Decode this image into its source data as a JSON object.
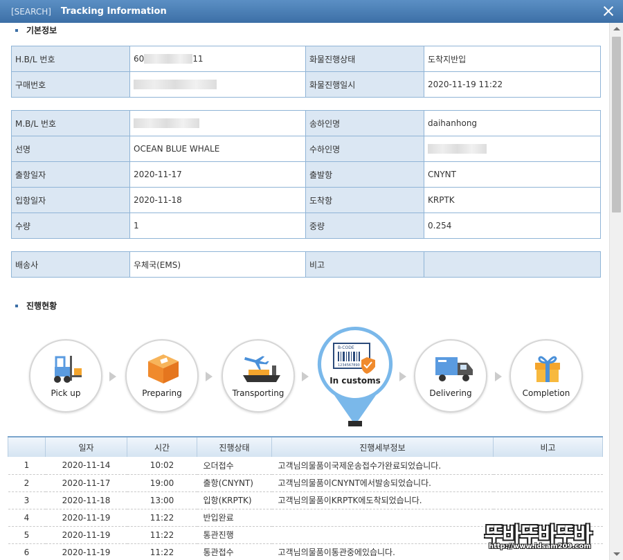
{
  "window": {
    "tag": "[SEARCH]",
    "title": "Tracking Information"
  },
  "sections": {
    "basic": "기본정보",
    "progress": "진행현황"
  },
  "hbl": {
    "hbl_label": "H.B/L 번호",
    "hbl_value_start": "60",
    "hbl_value_end": "11",
    "status_label": "화물진행상태",
    "status_value": "도착지반입",
    "purchase_label": "구매번호",
    "status_time_label": "화물진행일시",
    "status_time_value": "2020-11-19 11:22"
  },
  "mbl": {
    "mbl_label": "M.B/L 번호",
    "shipper_label": "송하인명",
    "shipper_value": "daihanhong",
    "vessel_label": "선명",
    "vessel_value": "OCEAN BLUE WHALE",
    "consignee_label": "수하인명",
    "depart_date_label": "출항일자",
    "depart_date_value": "2020-11-17",
    "depart_port_label": "출발항",
    "depart_port_value": "CNYNT",
    "arrive_date_label": "입항일자",
    "arrive_date_value": "2020-11-18",
    "arrive_port_label": "도착항",
    "arrive_port_value": "KRPTK",
    "qty_label": "수량",
    "qty_value": "1",
    "weight_label": "중량",
    "weight_value": "0.254"
  },
  "carrier": {
    "carrier_label": "배송사",
    "carrier_value": "우체국(EMS)",
    "note_label": "비고",
    "note_value": ""
  },
  "steps": [
    {
      "label": "Pick up",
      "icon": "forklift-icon"
    },
    {
      "label": "Preparing",
      "icon": "box-icon"
    },
    {
      "label": "Transporting",
      "icon": "ship-plane-icon"
    },
    {
      "label": "In customs",
      "icon": "customs-barcode-icon",
      "active": true,
      "stamp": "B-CODE",
      "barcode_no": "1234567890"
    },
    {
      "label": "Delivering",
      "icon": "truck-icon"
    },
    {
      "label": "Completion",
      "icon": "gift-icon"
    }
  ],
  "history": {
    "headers": [
      "",
      "일자",
      "시간",
      "진행상태",
      "진행세부정보",
      "비고"
    ],
    "rows": [
      {
        "no": "1",
        "date": "2020-11-14",
        "time": "10:02",
        "status": "오더접수",
        "detail": "고객님의물품이국제운송접수가완료되었습니다.",
        "note": ""
      },
      {
        "no": "2",
        "date": "2020-11-17",
        "time": "19:00",
        "status": "출항(CNYNT)",
        "detail": "고객님의물품이CNYNT에서발송되었습니다.",
        "note": ""
      },
      {
        "no": "3",
        "date": "2020-11-18",
        "time": "13:00",
        "status": "입항(KRPTK)",
        "detail": "고객님의물품이KRPTK에도착되었습니다.",
        "note": ""
      },
      {
        "no": "4",
        "date": "2020-11-19",
        "time": "11:22",
        "status": "반입완료",
        "detail": "",
        "note": ""
      },
      {
        "no": "5",
        "date": "2020-11-19",
        "time": "11:22",
        "status": "통관진행",
        "detail": "",
        "note": ""
      },
      {
        "no": "6",
        "date": "2020-11-19",
        "time": "11:22",
        "status": "통관접수",
        "detail": "고객님의물품이통관중에있습니다.",
        "note": ""
      }
    ]
  },
  "watermark": {
    "text": "뚜바뚜바뚜바",
    "url": "http://www.idsam209.com"
  },
  "colors": {
    "accent": "#3c6fa6",
    "label_bg": "#dbe7f3",
    "active": "#7ab8ea"
  }
}
